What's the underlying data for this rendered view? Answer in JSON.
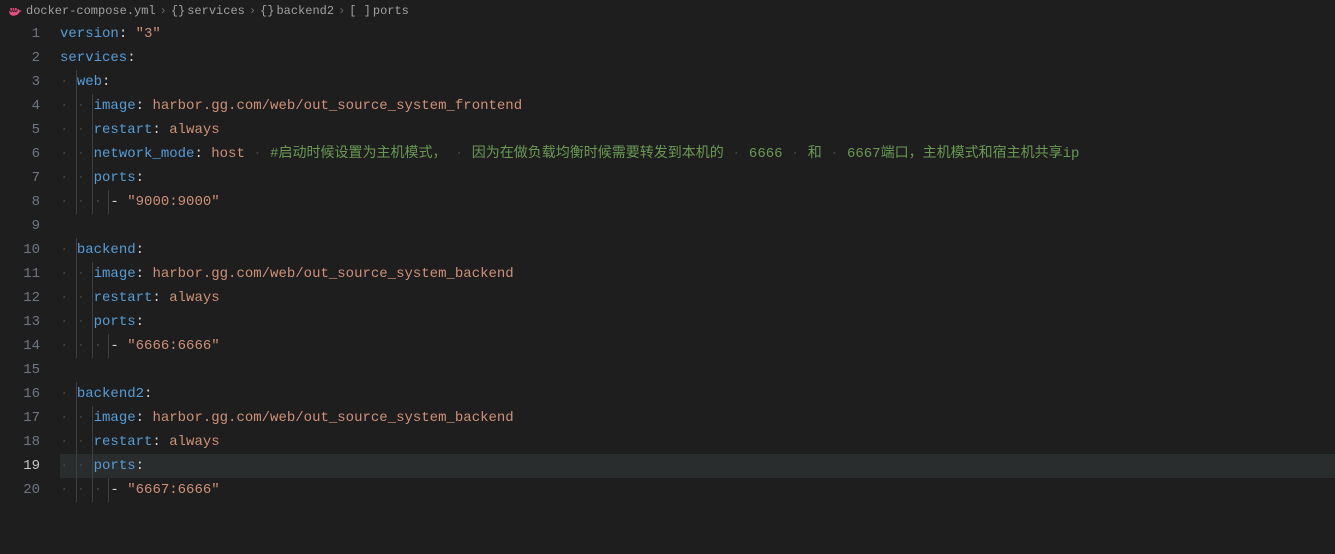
{
  "breadcrumb": {
    "file": "docker-compose.yml",
    "path": [
      {
        "icon": "{}",
        "label": "services"
      },
      {
        "icon": "{}",
        "label": "backend2"
      },
      {
        "icon": "[ ]",
        "label": "ports"
      }
    ]
  },
  "editor": {
    "activeLine": 19,
    "lines": [
      {
        "n": 1,
        "indent": 0,
        "tokens": [
          {
            "t": "key",
            "v": "version"
          },
          {
            "t": "colon",
            "v": ": "
          },
          {
            "t": "str",
            "v": "\"3\""
          }
        ]
      },
      {
        "n": 2,
        "indent": 0,
        "tokens": [
          {
            "t": "key",
            "v": "services"
          },
          {
            "t": "colon",
            "v": ":"
          }
        ]
      },
      {
        "n": 3,
        "indent": 1,
        "tokens": [
          {
            "t": "key",
            "v": "web"
          },
          {
            "t": "colon",
            "v": ":"
          }
        ]
      },
      {
        "n": 4,
        "indent": 2,
        "tokens": [
          {
            "t": "key",
            "v": "image"
          },
          {
            "t": "colon",
            "v": ": "
          },
          {
            "t": "str",
            "v": "harbor.gg.com/web/out_source_system_frontend"
          }
        ]
      },
      {
        "n": 5,
        "indent": 2,
        "tokens": [
          {
            "t": "key",
            "v": "restart"
          },
          {
            "t": "colon",
            "v": ": "
          },
          {
            "t": "str",
            "v": "always"
          }
        ]
      },
      {
        "n": 6,
        "indent": 2,
        "tokens": [
          {
            "t": "key",
            "v": "network_mode"
          },
          {
            "t": "colon",
            "v": ": "
          },
          {
            "t": "str",
            "v": "host"
          },
          {
            "t": "ws",
            "v": " · "
          },
          {
            "t": "comment",
            "v": "#启动时候设置为主机模式， · 因为在做负载均衡时候需要转发到本机的 · 6666 · 和 · 6667端口，主机模式和宿主机共享ip"
          }
        ]
      },
      {
        "n": 7,
        "indent": 2,
        "tokens": [
          {
            "t": "key",
            "v": "ports"
          },
          {
            "t": "colon",
            "v": ":"
          }
        ]
      },
      {
        "n": 8,
        "indent": 3,
        "tokens": [
          {
            "t": "dash",
            "v": "- "
          },
          {
            "t": "str",
            "v": "\"9000:9000\""
          }
        ]
      },
      {
        "n": 9,
        "indent": 0,
        "tokens": []
      },
      {
        "n": 10,
        "indent": 1,
        "tokens": [
          {
            "t": "key",
            "v": "backend"
          },
          {
            "t": "colon",
            "v": ":"
          }
        ]
      },
      {
        "n": 11,
        "indent": 2,
        "tokens": [
          {
            "t": "key",
            "v": "image"
          },
          {
            "t": "colon",
            "v": ": "
          },
          {
            "t": "str",
            "v": "harbor.gg.com/web/out_source_system_backend"
          }
        ]
      },
      {
        "n": 12,
        "indent": 2,
        "tokens": [
          {
            "t": "key",
            "v": "restart"
          },
          {
            "t": "colon",
            "v": ": "
          },
          {
            "t": "str",
            "v": "always"
          }
        ]
      },
      {
        "n": 13,
        "indent": 2,
        "tokens": [
          {
            "t": "key",
            "v": "ports"
          },
          {
            "t": "colon",
            "v": ":"
          }
        ]
      },
      {
        "n": 14,
        "indent": 3,
        "tokens": [
          {
            "t": "dash",
            "v": "- "
          },
          {
            "t": "str",
            "v": "\"6666:6666\""
          }
        ]
      },
      {
        "n": 15,
        "indent": 0,
        "tokens": []
      },
      {
        "n": 16,
        "indent": 1,
        "tokens": [
          {
            "t": "key",
            "v": "backend2"
          },
          {
            "t": "colon",
            "v": ":"
          }
        ]
      },
      {
        "n": 17,
        "indent": 2,
        "tokens": [
          {
            "t": "key",
            "v": "image"
          },
          {
            "t": "colon",
            "v": ": "
          },
          {
            "t": "str",
            "v": "harbor.gg.com/web/out_source_system_backend"
          }
        ]
      },
      {
        "n": 18,
        "indent": 2,
        "tokens": [
          {
            "t": "key",
            "v": "restart"
          },
          {
            "t": "colon",
            "v": ": "
          },
          {
            "t": "str",
            "v": "always"
          }
        ]
      },
      {
        "n": 19,
        "indent": 2,
        "tokens": [
          {
            "t": "key",
            "v": "ports"
          },
          {
            "t": "colon",
            "v": ":"
          }
        ]
      },
      {
        "n": 20,
        "indent": 3,
        "tokens": [
          {
            "t": "dash",
            "v": "- "
          },
          {
            "t": "str",
            "v": "\"6667:6666\""
          }
        ]
      }
    ]
  }
}
